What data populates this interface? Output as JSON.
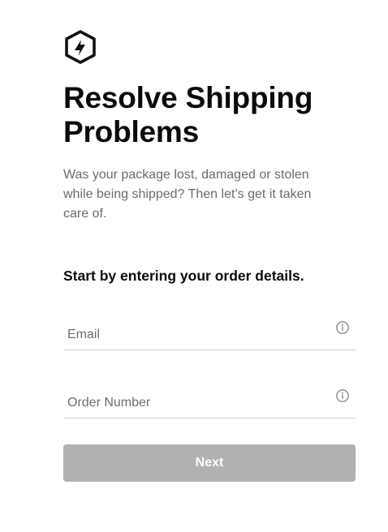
{
  "brand": {
    "logo_icon": "hexagon-lightning-logo-icon"
  },
  "header": {
    "title_line1": "Resolve Shipping",
    "title_line2": "Problems",
    "subtitle": "Was your package lost, damaged or stolen while being shipped? Then let’s get it taken care of."
  },
  "form": {
    "prompt": "Start by entering your order details.",
    "email": {
      "placeholder": "Email",
      "value": "",
      "info_icon": "info-circle-icon"
    },
    "order_number": {
      "placeholder": "Order Number",
      "value": "",
      "info_icon": "info-circle-icon"
    },
    "next_label": "Next",
    "next_enabled": false
  },
  "colors": {
    "title": "#0a0a0a",
    "subtitle": "#6b6b6b",
    "field_border": "#d0d0d0",
    "button_disabled_bg": "#b1b1b1",
    "button_text": "#ffffff"
  }
}
